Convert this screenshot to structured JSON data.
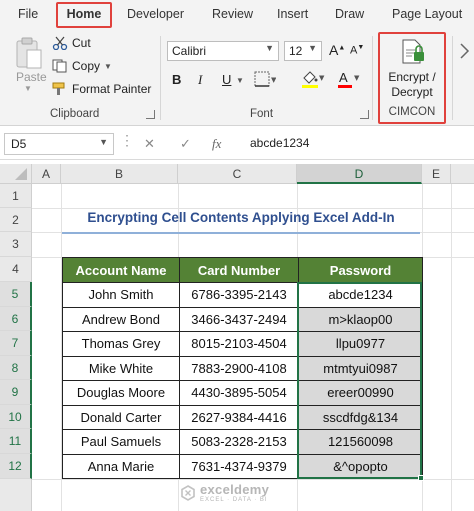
{
  "menu": {
    "tabs": [
      "File",
      "Home",
      "Developer",
      "Review",
      "Insert",
      "Draw",
      "Page Layout"
    ],
    "active_tab": "Home"
  },
  "ribbon": {
    "clipboard": {
      "paste": "Paste",
      "cut": "Cut",
      "copy": "Copy",
      "format_painter": "Format Painter",
      "label": "Clipboard"
    },
    "font": {
      "family": "Calibri",
      "size": "12",
      "label": "Font",
      "bold": "B",
      "italic": "I",
      "underline": "U",
      "grow": "A",
      "shrink": "A",
      "font_color": "A",
      "highlight_color": "#ffff00",
      "font_color_value": "#ff0000"
    },
    "cimcon": {
      "button_line1": "Encrypt /",
      "button_line2": "Decrypt",
      "label": "CIMCON"
    }
  },
  "formula_bar": {
    "name_box": "D5",
    "fx": "fx",
    "value": "abcde1234"
  },
  "columns": [
    "A",
    "B",
    "C",
    "D",
    "E"
  ],
  "selected_column": "D",
  "rows": [
    "1",
    "2",
    "3",
    "4",
    "5",
    "6",
    "7",
    "8",
    "9",
    "10",
    "11",
    "12"
  ],
  "sheet": {
    "title": "Encrypting Cell Contents Applying Excel Add-In",
    "headers": [
      "Account Name",
      "Card Number",
      "Password"
    ],
    "records": [
      [
        "John Smith",
        "6786-3395-2143",
        "abcde1234"
      ],
      [
        "Andrew Bond",
        "3466-3437-2494",
        "m>klaop00"
      ],
      [
        "Thomas Grey",
        "8015-2103-4504",
        "llpu0977"
      ],
      [
        "Mike White",
        "7883-2900-4108",
        "mtmtyui0987"
      ],
      [
        "Douglas Moore",
        "4430-3895-5054",
        "ereer00990"
      ],
      [
        "Donald Carter",
        "2627-9384-4416",
        "sscdfdg&134"
      ],
      [
        "Paul Samuels",
        "5083-2328-2153",
        "121560098"
      ],
      [
        "Anna Marie",
        "7631-4374-9379",
        "&^opopto"
      ]
    ]
  },
  "watermark": {
    "name": "exceldemy",
    "tagline": "EXCEL · DATA · BI"
  },
  "colors": {
    "header_green": "#548235",
    "selection_green": "#217346",
    "highlight_red": "#e0413c",
    "title_blue": "#2f4f8f",
    "encrypted_gray": "#d9d9d9"
  }
}
